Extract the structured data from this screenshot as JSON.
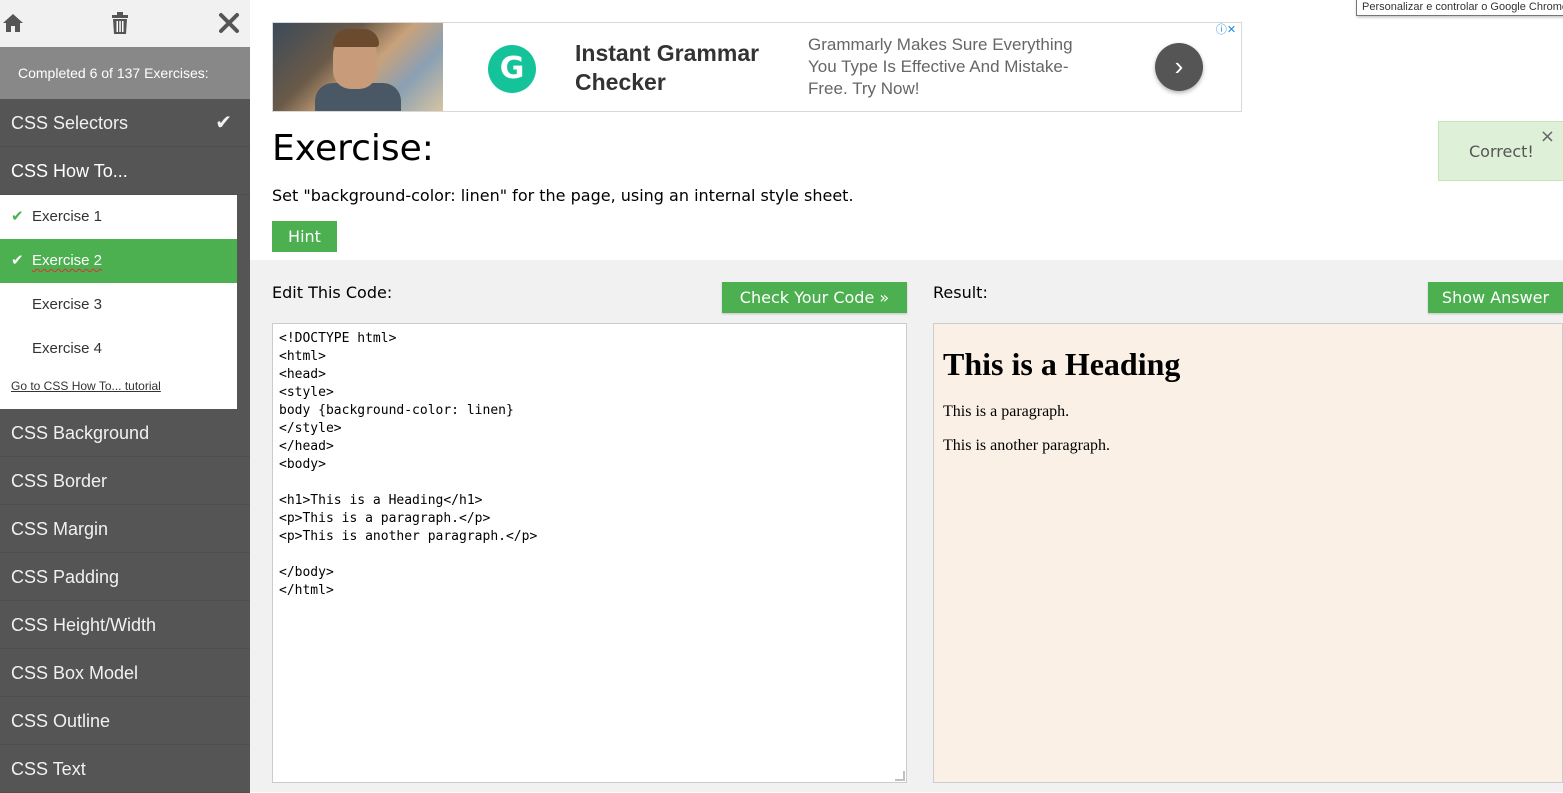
{
  "sidebar": {
    "top_icons": [
      "home-icon",
      "trash-icon",
      "close-icon"
    ],
    "progress_text": "Completed 6 of 137 Exercises:",
    "items_before": [
      {
        "label": "CSS Selectors",
        "completed": true
      },
      {
        "label": "CSS How To...",
        "completed": false
      }
    ],
    "sub_items": [
      {
        "label": "Exercise 1",
        "completed": true
      },
      {
        "label": "Exercise 2",
        "completed": true
      },
      {
        "label": "Exercise 3",
        "completed": false
      },
      {
        "label": "Exercise 4",
        "completed": false
      }
    ],
    "tutorial_link": "Go to CSS How To... tutorial",
    "items_after": [
      {
        "label": "CSS Background"
      },
      {
        "label": "CSS Border"
      },
      {
        "label": "CSS Margin"
      },
      {
        "label": "CSS Padding"
      },
      {
        "label": "CSS Height/Width"
      },
      {
        "label": "CSS Box Model"
      },
      {
        "label": "CSS Outline"
      },
      {
        "label": "CSS Text"
      }
    ]
  },
  "ad": {
    "title": "Instant Grammar Checker",
    "description": "Grammarly Makes Sure Everything You Type Is Effective And Mistake-Free. Try Now!",
    "logo_letter": "G",
    "arrow": "›",
    "choices": "ⓘ✕"
  },
  "exercise": {
    "title": "Exercise:",
    "description": "Set \"background-color: linen\" for the page, using an internal style sheet.",
    "hint_label": "Hint"
  },
  "toast": {
    "text": "Correct!",
    "close": "×"
  },
  "tooltip": "Personalizar e controlar o Google Chrome",
  "workspace": {
    "edit_label": "Edit This Code:",
    "check_button": "Check Your Code »",
    "result_label": "Result:",
    "answer_button": "Show Answer",
    "code": "<!DOCTYPE html>\n<html>\n<head>\n<style>\nbody {background-color: linen}\n</style>\n</head>\n<body>\n\n<h1>This is a Heading</h1>\n<p>This is a paragraph.</p>\n<p>This is another paragraph.</p>\n\n</body>\n</html>"
  },
  "result": {
    "heading": "This is a Heading",
    "paragraphs": [
      "This is a paragraph.",
      "This is another paragraph."
    ],
    "background": "#faf0e6"
  },
  "colors": {
    "accent": "#4caf50",
    "sidebar_bg": "#555555"
  }
}
